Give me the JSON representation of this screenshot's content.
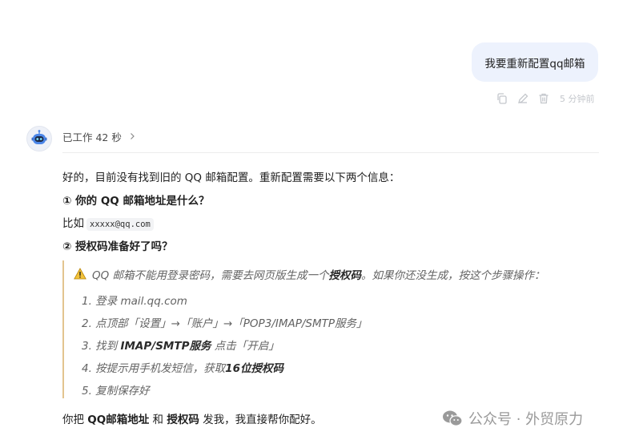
{
  "user_message": "我要重新配置qq邮箱",
  "message_actions": {
    "copy_icon": "copy-icon",
    "edit_icon": "pencil-icon",
    "delete_icon": "trash-icon",
    "time": "5 分钟前"
  },
  "assistant": {
    "work_status": "已工作 42 秒",
    "intro": "好的，目前没有找到旧的 QQ 邮箱配置。重新配置需要以下两个信息：",
    "q1_heading": "① 你的 QQ 邮箱地址是什么？",
    "example_prefix": "比如",
    "example_code": "xxxxx@qq.com",
    "q2_heading": "② 授权码准备好了吗？",
    "quote": {
      "note_part1": "QQ 邮箱不能用登录密码，需要去网页版生成一个",
      "note_bold": "授权码",
      "note_part2": "。如果你还没生成，按这个步骤操作：",
      "step1": "1. 登录 mail.qq.com",
      "step2": "2. 点顶部「设置」→「账户」→「POP3/IMAP/SMTP服务」",
      "step3_pre": "3. 找到 ",
      "step3_bold": "IMAP/SMTP服务",
      "step3_post": " 点击「开启」",
      "step4_pre": "4. 按提示用手机发短信，获取",
      "step4_bold": "16位授权码",
      "step5": "5. 复制保存好"
    },
    "closing_pre": "你把 ",
    "closing_bold1": "QQ邮箱地址",
    "closing_mid": " 和 ",
    "closing_bold2": "授权码",
    "closing_post": " 发我，我直接帮你配好。"
  },
  "watermark": {
    "text": "公众号 · 外贸原力"
  },
  "colors": {
    "user_bubble": "#edf2fd",
    "quote_bar": "#e3c48f",
    "warning": "#f2c23a"
  }
}
